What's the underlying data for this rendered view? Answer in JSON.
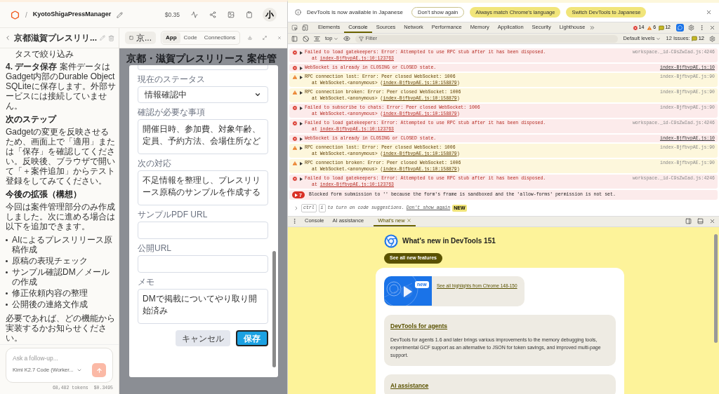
{
  "app_header": {
    "separator": "/",
    "project": "KyotoShigaPressManager",
    "cost": "$0.35",
    "avatar": "小"
  },
  "chat": {
    "title": "京都滋賀プレスリリ...",
    "blocks": [
      {
        "kind": "continuation",
        "text": "タスで絞り込み"
      },
      {
        "kind": "paragraph",
        "text": "**4. データ保存** 案件データはGadget内部のDurable Object SQLiteに保存します。外部サービスには接続していません。"
      },
      {
        "kind": "heading",
        "text": "次のステップ"
      },
      {
        "kind": "paragraph",
        "text": "Gadgetの変更を反映させるため、画面上で「適用」または「保存」を確認してください。反映後、ブラウザで開いて「＋案件追加」からテスト登録をしてみてください。"
      },
      {
        "kind": "heading",
        "text": "今後の拡張（構想）"
      },
      {
        "kind": "paragraph",
        "text": "今回は案件管理部分のみ作成しました。次に進める場合は以下を追加できます。"
      },
      {
        "kind": "bullets",
        "items": [
          "AIによるプレスリリース原稿作成",
          "原稿の表現チェック",
          "サンプル確認DM／メールの作成",
          "修正依頼内容の整理",
          "公開後の連絡文作成"
        ]
      },
      {
        "kind": "paragraph",
        "text": "必要であれば、どの機能から実装するかお知らせください。"
      }
    ],
    "input": {
      "placeholder": "Ask a follow-up..."
    },
    "model": "Kimi K2.7 Code (Worker...",
    "tokens": "68,482 tokens",
    "cost": "$0.3495"
  },
  "preview": {
    "file_button": "京...",
    "tabs": [
      {
        "label": "App",
        "selected": true
      },
      {
        "label": "Code",
        "selected": false
      },
      {
        "label": "Connections",
        "selected": false
      }
    ],
    "page_title": "京都・滋賀プレスリリース 案件管",
    "form": {
      "fields": [
        {
          "label": "現在のステータス",
          "kind": "select",
          "value": "情報確認中"
        },
        {
          "label": "確認が必要な事項",
          "kind": "textarea",
          "value": "開催日時、参加費、対象年齢、定員、予約方法、会場住所など"
        },
        {
          "label": "次の対応",
          "kind": "textarea",
          "value": "不足情報を整理し、プレスリリース原稿のサンプルを作成する"
        },
        {
          "label": "サンプルPDF URL",
          "kind": "input"
        },
        {
          "label": "公開URL",
          "kind": "input"
        },
        {
          "label": "メモ",
          "kind": "textarea",
          "value": "DMで掲載についてやり取り開始済み"
        }
      ],
      "buttons": [
        {
          "label": "キャンセル",
          "kind": "secondary"
        },
        {
          "label": "保存",
          "kind": "primary"
        }
      ]
    }
  },
  "devtools": {
    "infobar": {
      "message": "DevTools is now available in Japanese",
      "buttons": [
        {
          "label": "Don't show again",
          "kind": "outline"
        },
        {
          "label": "Always match Chrome's language",
          "kind": "filled"
        },
        {
          "label": "Switch DevTools to Japanese",
          "kind": "filled"
        }
      ]
    },
    "tabs": [
      {
        "label": "Elements",
        "selected": false
      },
      {
        "label": "Console",
        "selected": true
      },
      {
        "label": "Sources",
        "selected": false
      },
      {
        "label": "Network",
        "selected": false
      },
      {
        "label": "Performance",
        "selected": false
      },
      {
        "label": "Memory",
        "selected": false
      },
      {
        "label": "Application",
        "selected": false
      },
      {
        "label": "Security",
        "selected": false
      },
      {
        "label": "Lighthouse",
        "selected": false
      }
    ],
    "counts": {
      "errors": "14",
      "warnings": "6",
      "info": "12"
    },
    "console_toolbar": {
      "context": "top",
      "filter_placeholder": "Filter",
      "levels": "Default levels",
      "issues_label": "12 Issues:",
      "issues_count": "12"
    },
    "messages": [
      {
        "kind": "error",
        "text": "Failed to load gatekeepers: Error: Attempted to use RPC stub after it has been disposed.",
        "stack": {
          "prefix": "at ",
          "link": "index-BjfbvpAE.js:10:123763"
        },
        "source": "workspace._id-C9sZwIad.js:4246",
        "source_link": false
      },
      {
        "kind": "error",
        "text": "WebSocket is already in CLOSING or CLOSED state.",
        "source": "index-BjfbvpAE.js:10",
        "source_link": true
      },
      {
        "kind": "warning",
        "text": "RPC connection lost: Error: Peer closed WebSocket: 1006",
        "stack": {
          "prefix": "at WebSocket.<anonymous> (",
          "link": "index-BjfbvpAE.js:10:158879",
          "suffix": ")"
        },
        "source": "index-BjfbvpAE.js:90",
        "source_link": false
      },
      {
        "kind": "warning",
        "text": "RPC connection broken: Error: Peer closed WebSocket: 1006",
        "stack": {
          "prefix": "at WebSocket.<anonymous> (",
          "link": "index-BjfbvpAE.js:10:158879",
          "suffix": ")"
        },
        "source": "index-BjfbvpAE.js:90",
        "source_link": false
      },
      {
        "kind": "error",
        "text": "Failed to subscribe to chats: Error: Peer closed WebSocket: 1006",
        "stack": {
          "prefix": "at WebSocket.<anonymous> (",
          "link": "index-BjfbvpAE.js:10:158879",
          "suffix": ")"
        },
        "source": "index-BjfbvpAE.js:90",
        "source_link": false
      },
      {
        "kind": "error",
        "text": "Failed to load gatekeepers: Error: Attempted to use RPC stub after it has been disposed.",
        "stack": {
          "prefix": "at ",
          "link": "index-BjfbvpAE.js:10:123763"
        },
        "source": "workspace._id-C9sZwIad.js:4246",
        "source_link": false
      },
      {
        "kind": "error",
        "text": "WebSocket is already in CLOSING or CLOSED state.",
        "source": "index-BjfbvpAE.js:10",
        "source_link": true
      },
      {
        "kind": "warning",
        "text": "RPC connection lost: Error: Peer closed WebSocket: 1006",
        "stack": {
          "prefix": "at WebSocket.<anonymous> (",
          "link": "index-BjfbvpAE.js:10:158879",
          "suffix": ")"
        },
        "source": "index-BjfbvpAE.js:90",
        "source_link": false
      },
      {
        "kind": "warning",
        "text": "RPC connection broken: Error: Peer closed WebSocket: 1006",
        "stack": {
          "prefix": "at WebSocket.<anonymous> (",
          "link": "index-BjfbvpAE.js:10:158879",
          "suffix": ")"
        },
        "source": "index-BjfbvpAE.js:90",
        "source_link": false
      },
      {
        "kind": "error",
        "text": "Failed to load gatekeepers: Error: Attempted to use RPC stub after it has been disposed.",
        "stack": {
          "prefix": "at ",
          "link": "index-BjfbvpAE.js:10:123763"
        },
        "source": "workspace._id-C9sZwIad.js:4246",
        "source_link": false
      },
      {
        "kind": "grouped",
        "count": "7",
        "text": "Blocked form submission to '' because the form's frame is sandboxed and the 'allow-forms' permission is not set."
      }
    ],
    "prompt": {
      "keys": [
        "ctrl",
        "i"
      ],
      "hint": "to turn on code suggestions.",
      "link": "Don't show again",
      "badge": "NEW"
    },
    "drawer_tabs": [
      {
        "label": "Console",
        "selected": false,
        "closable": false
      },
      {
        "label": "AI assistance",
        "selected": false,
        "closable": false
      },
      {
        "label": "What's new",
        "selected": true,
        "closable": true
      }
    ],
    "whats_new": {
      "title": "What's new in DevTools 151",
      "button": "See all new features",
      "video": {
        "kind": "picture",
        "badge": "new",
        "link": "See all highlights from Chrome 148-150"
      },
      "features": [
        {
          "title": "DevTools for agents",
          "body": "DevTools for agents 1.6 and later brings various improvements to the memory debugging tools, experimental GCF support as an alternative to JSON for token savings, and improved multi-page support."
        },
        {
          "title": "AI assistance"
        }
      ]
    }
  }
}
